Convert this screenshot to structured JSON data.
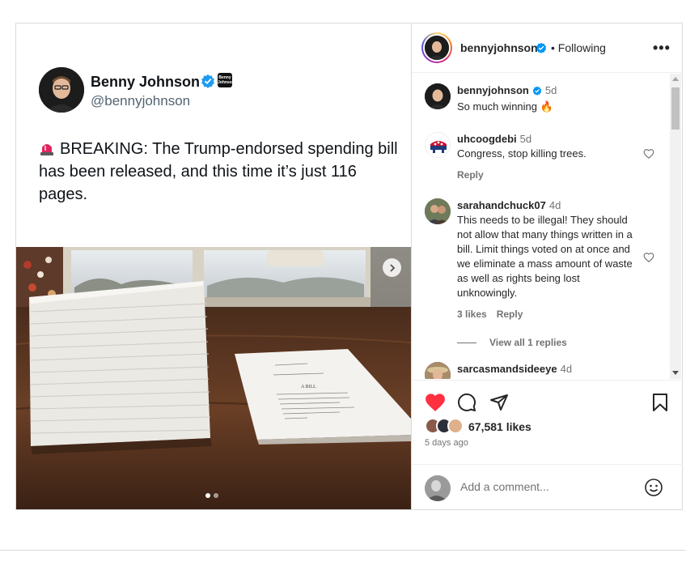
{
  "tweet": {
    "name": "Benny Johnson",
    "handle": "@bennyjohnson",
    "badge_text": "Benny Johnson",
    "text": "BREAKING: The Trump-endorsed spending bill has been released, and this time it’s just 116 pages."
  },
  "photo": {
    "small_doc_heading": "A BILL"
  },
  "header": {
    "username": "bennyjohnson",
    "separator_follow": "• Following",
    "more": "•••"
  },
  "comments": [
    {
      "user": "bennyjohnson",
      "time": "5d",
      "text": "So much winning 🔥"
    },
    {
      "user": "uhcoogdebi",
      "time": "5d",
      "text": "Congress, stop killing trees.",
      "reply": "Reply"
    },
    {
      "user": "sarahandchuck07",
      "time": "4d",
      "text": "This needs to be illegal! They should not allow that many things written in a bill. Limit things voted on at once and we eliminate a mass amount of waste as well as rights being lost unknowingly.",
      "likes": "3 likes",
      "reply": "Reply"
    },
    {
      "user": "sarcasmandsideeye",
      "time": "4d",
      "text": ""
    }
  ],
  "view_replies": "View all 1 replies",
  "likes": "67,581 likes",
  "posted": "5 days ago",
  "add_comment": {
    "placeholder": "Add a comment..."
  },
  "colors": {
    "verified": "#0095f6",
    "liked": "#ff3040",
    "muted": "#737373"
  }
}
